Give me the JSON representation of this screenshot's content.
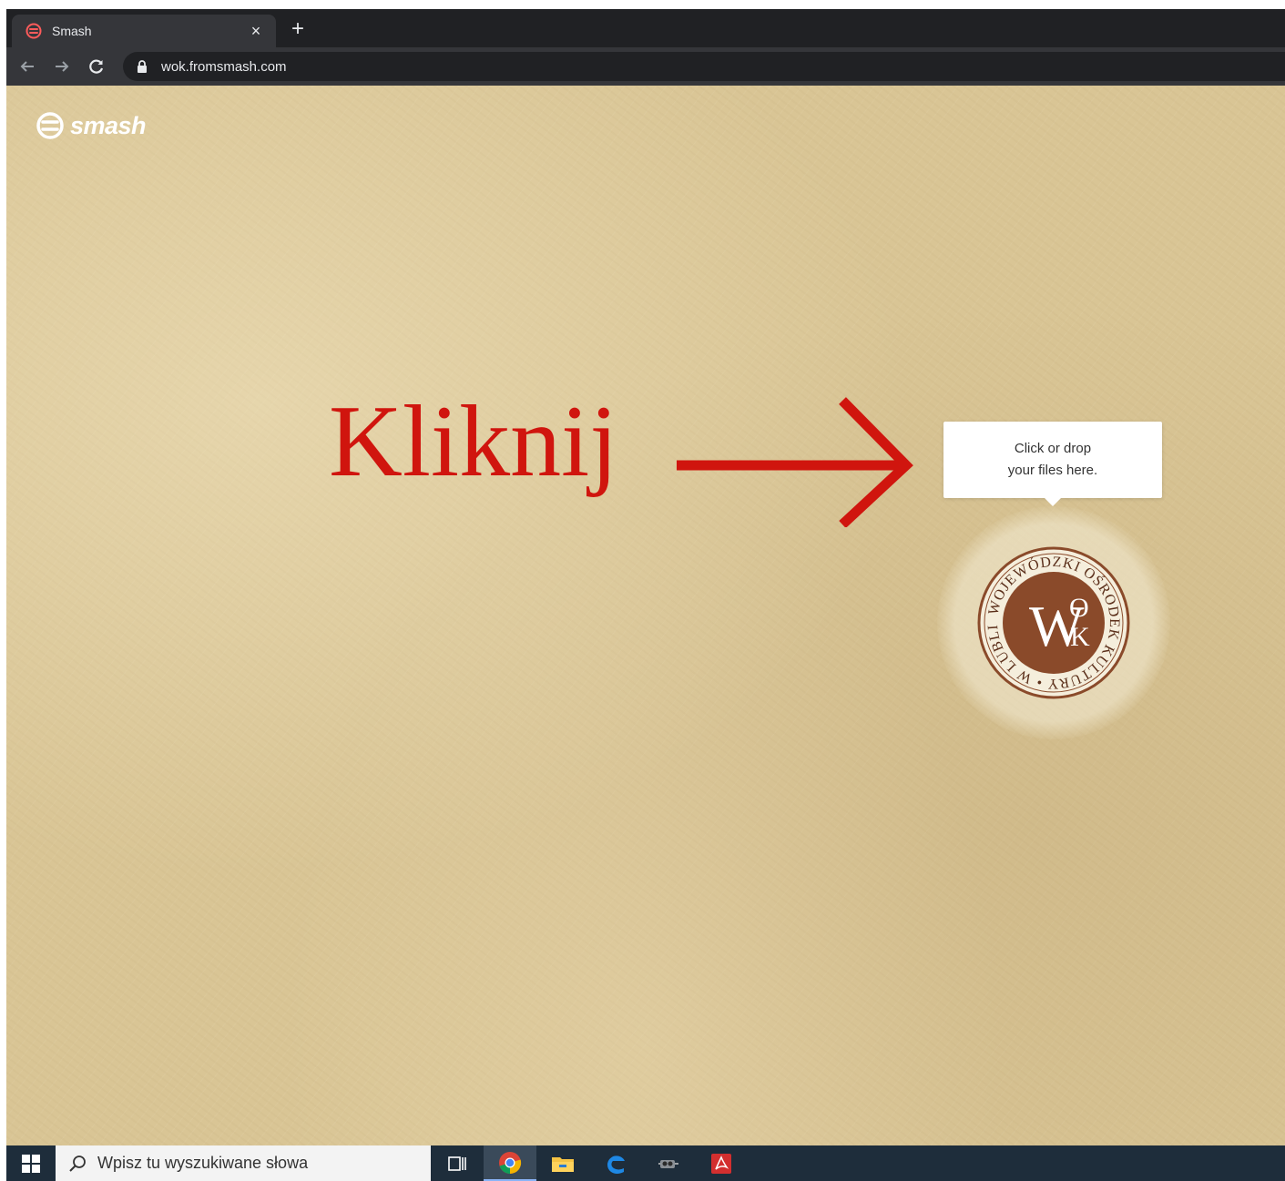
{
  "browser": {
    "tab_title": "Smash",
    "close_symbol": "×",
    "new_tab_symbol": "+",
    "url": "wok.fromsmash.com",
    "icons": [
      "back-arrow-icon",
      "forward-arrow-icon",
      "reload-icon",
      "lock-icon",
      "close-icon",
      "plus-icon"
    ]
  },
  "page": {
    "logo_text": "smash",
    "annotation_text": "Kliknij",
    "annotation_color": "#d0150e",
    "dropzone": {
      "tooltip_line1": "Click or drop",
      "tooltip_line2": "your files here."
    },
    "seal": {
      "ring_text": "WOJEWÓDZKI OŚRODEK KULTURY • W LUBLINIE •",
      "monogram_w": "W",
      "monogram_o": "O",
      "monogram_k": "K",
      "color": "#8a4a2a"
    },
    "background_color": "#d9c595"
  },
  "taskbar": {
    "search_placeholder": "Wpisz tu wyszukiwane słowa",
    "icons": [
      "windows-start-icon",
      "search-icon",
      "task-view-icon",
      "chrome-icon",
      "file-explorer-icon",
      "edge-icon",
      "mixer-icon",
      "acrobat-icon"
    ]
  }
}
